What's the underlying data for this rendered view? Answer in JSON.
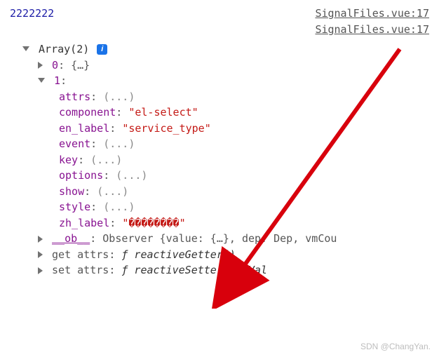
{
  "log_output": "2222222",
  "source_links": [
    "SignalFiles.vue:17",
    "SignalFiles.vue:17"
  ],
  "tree": {
    "array_header": "Array(2)",
    "item0": {
      "index": "0",
      "preview": "{…}"
    },
    "item1": {
      "index": "1",
      "attrs_key": "attrs",
      "placeholder": "(...)",
      "component_key": "component",
      "component_val": "\"el-select\"",
      "en_label_key": "en_label",
      "en_label_val": "\"service_type\"",
      "event_key": "event",
      "key_key": "key",
      "options_key": "options",
      "show_key": "show",
      "style_key": "style",
      "zh_label_key": "zh_label",
      "zh_label_val": "\"��������\"",
      "ob_key": "__ob__",
      "ob_val": "Observer {value: {…}, dep: Dep, vmCou",
      "get_attrs_key": "get attrs",
      "reactive_getter": " reactiveGetter()",
      "set_attrs_key": "set attrs",
      "reactive_setter": " reactiveSetter(newVal"
    }
  },
  "colon": ": ",
  "func_glyph": "ƒ",
  "info_glyph": "i",
  "watermark": "SDN @ChangYan."
}
